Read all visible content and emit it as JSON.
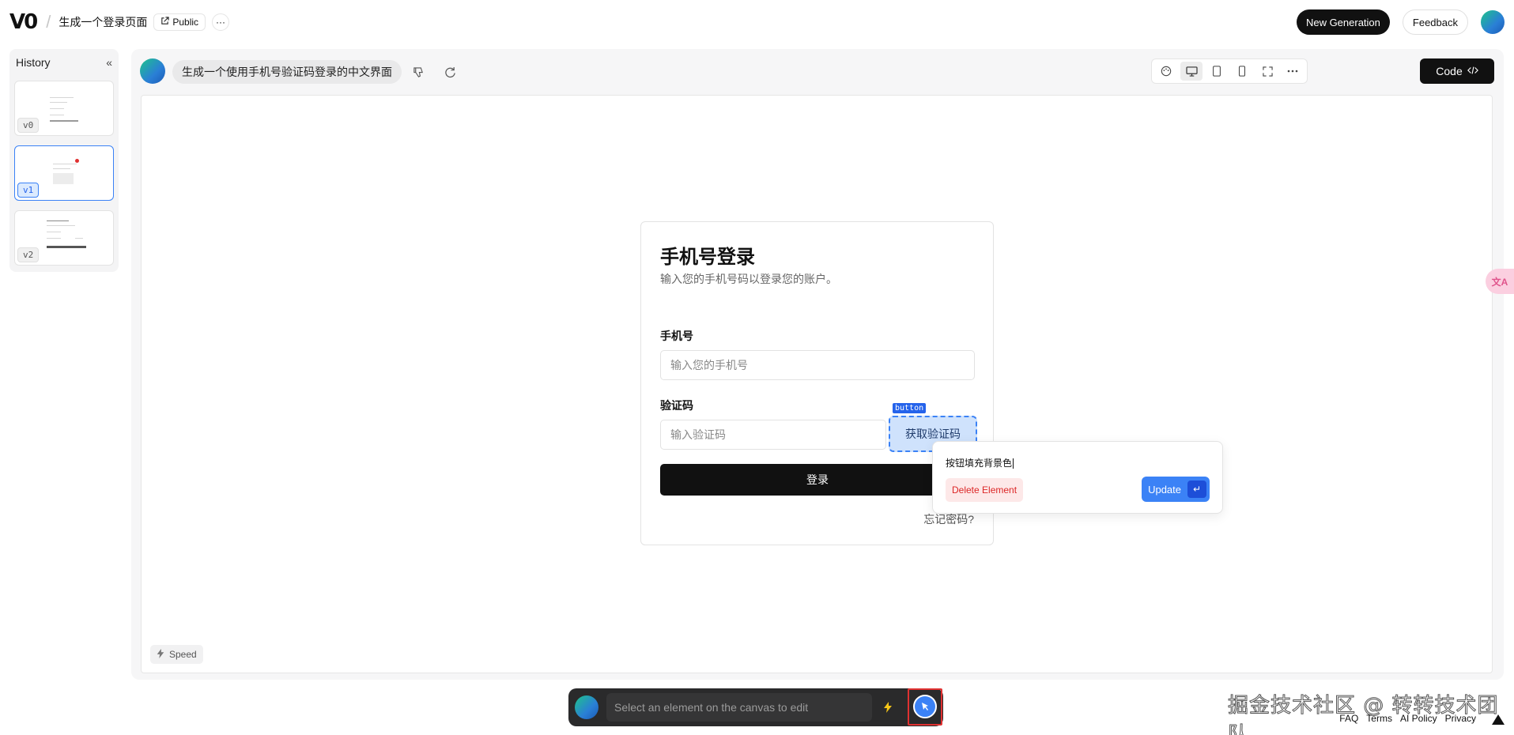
{
  "header": {
    "logo": "V0",
    "project_title": "生成一个登录页面",
    "public_label": "Public",
    "more_label": "···",
    "new_generation_label": "New Generation",
    "feedback_label": "Feedback"
  },
  "history": {
    "title": "History",
    "versions": [
      {
        "label": "v0",
        "selected": false
      },
      {
        "label": "v1",
        "selected": true
      },
      {
        "label": "v2",
        "selected": false
      }
    ]
  },
  "canvas_header": {
    "prompt": "生成一个使用手机号验证码登录的中文界面",
    "code_label": "Code"
  },
  "login_card": {
    "title": "手机号登录",
    "subtitle": "输入您的手机号码以登录您的账户。",
    "phone_label": "手机号",
    "phone_placeholder": "输入您的手机号",
    "code_label": "验证码",
    "code_placeholder": "输入验证码",
    "get_code_label": "获取验证码",
    "login_label": "登录",
    "forgot_label": "忘记密码?"
  },
  "selection": {
    "tag": "button",
    "edit_text": "按钮填充背景色",
    "delete_label": "Delete Element",
    "update_label": "Update",
    "enter_glyph": "↵"
  },
  "speed_label": "Speed",
  "translate_label": "文A",
  "chat": {
    "placeholder": "Select an element on the canvas to edit"
  },
  "watermark": "掘金技术社区 @ 转转技术团队",
  "footer": {
    "links": [
      "FAQ",
      "Terms",
      "AI Policy",
      "Privacy"
    ]
  },
  "colors": {
    "accent": "#3b82f6",
    "dark": "#111111",
    "danger": "#dc2626"
  }
}
